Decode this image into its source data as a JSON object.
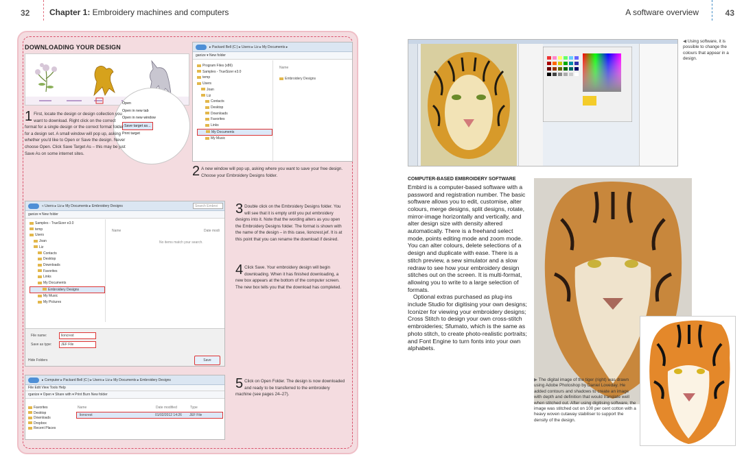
{
  "header": {
    "left_page_number": "32",
    "left_chapter_bold": "Chapter 1:",
    "left_chapter_rest": " Embroidery machines and computers",
    "right_section": "A software overview",
    "right_page_number": "43"
  },
  "panel": {
    "title": "DOWNLOADING YOUR DESIGN",
    "step1": {
      "num": "1",
      "text": "First, locate the design or design collection you want to download. Right click on the correct format for a single design or the correct format folder for a design set. A small window will pop up, asking whether you'd like to Open or Save the design. Never choose Open. Click Save Target As – this may be just Save As on some internet sites."
    },
    "step2": {
      "num": "2",
      "text": "A new window will pop up, asking where you want to save your free design. Choose your Embroidery Designs folder."
    },
    "step3": {
      "num": "3",
      "text": "Double click on the Embroidery Designs folder. You will see that it is empty until you put embroidery designs into it. Note that the wording alters as you open the Embroidery Designs folder. The format is shown with the name of the design – in this case, lioncrest.jef. It is at this point that you can rename the download if desired."
    },
    "step4": {
      "num": "4",
      "text": "Click Save. Your embroidery design will begin downloading. When it has finished downloading, a new box appears at the bottom of the computer screen. The new box tells you that the download has completed."
    },
    "step5": {
      "num": "5",
      "text": "Click on Open Folder. The design is now downloaded and ready to be transferred to the embroidery machine (see pages 24–27)."
    },
    "context_menu": [
      "Open",
      "Open in new tab",
      "Open in new window",
      "Save target as...",
      "Print target"
    ],
    "explorer1": {
      "path": "▸ Packard Bell (C:) ▸ Users ▸ Liz ▸ My Documents ▸",
      "toolbar": "ganize ▾     New folder",
      "tree": [
        "Program Files (x86)",
        "Samples - TrueSizer e3.0",
        "temp",
        "Users",
        "Joan",
        "Liz",
        "Contacts",
        "Desktop",
        "Downloads",
        "Favorites",
        "Links",
        "My Documents",
        "My Music"
      ],
      "col_header": "Name",
      "item": "Embroidery Designs"
    },
    "explorer2": {
      "path": "« Users ▸ Liz ▸ My Documents ▸ Embroidery Designs",
      "search": "Search Embroi",
      "toolbar": "ganize ▾     New folder",
      "tree": [
        "Samples - TrueSizer e3.0",
        "temp",
        "Users",
        "Joan",
        "Liz",
        "Contacts",
        "Desktop",
        "Downloads",
        "Favorites",
        "Links",
        "My Documents",
        "Embroidery Designs",
        "My Music",
        "My Pictures"
      ],
      "col_name": "Name",
      "col_date": "Date modi",
      "empty_msg": "No items match your search.",
      "file_name_label": "File name:",
      "file_name_value": "lioncrest",
      "save_type_label": "Save as type:",
      "save_type_value": "JEF File",
      "hide_folders": "Hide Folders",
      "save_button": "Save"
    },
    "explorer3": {
      "path": "▸ Computer ▸ Packard Bell (C:) ▸ Users ▸ Liz ▸ My Documents ▸ Embroidery Designs",
      "menu": "File   Edit   View   Tools   Help",
      "toolbar": "rganize ▾   Open ▾   Share with ▾   Print   Burn   New folder",
      "tree": [
        "Favorites",
        "Desktop",
        "Downloads",
        "Dropbox",
        "Recent Places"
      ],
      "col_name": "Name",
      "col_date": "Date modified",
      "col_type": "Type",
      "file": "lioncrest",
      "file_date": "01/02/2012 14:26",
      "file_type": "JEF File"
    }
  },
  "right": {
    "caption_top": "Using software, it is possible to change the colours that appear in a design.",
    "heading": "COMPUTER-BASED EMBROIDERY SOFTWARE",
    "para1": "Embird is a computer-based software with a password and registration number. The basic software allows you to edit, customise, alter colours, merge designs, split designs, rotate, mirror-image horizontally and vertically, and alter design size with density altered automatically. There is a freehand select mode, points editing mode and zoom mode. You can alter colours, delete selections of a design and duplicate with ease. There is a stitch preview, a sew simulator and a slow redraw to see how your embroidery design stitches out on the screen. It is multi-format, allowing you to write to a large selection of formats.",
    "para2": "Optional extras purchased as plug-ins include Studio for digitising your own designs; Iconizer for viewing your embroidery designs; Cross Stitch to design your own cross-stitch embroideries; Sfumato, which is the same as photo stitch, to create photo-realistic portraits; and Font Engine to turn fonts into your own alphabets.",
    "caption_bottom": "The digital image of the tiger (right) was drawn using Adobe Photoshop by Daniel Loveday. He added contours and shadows to create an image with depth and definition that would translate well when stitched out. After using digitising software, the image was stitched out on 100 per cent cotton with a heavy woven cutaway stabiliser to support the density of the design."
  },
  "colors": {
    "panel_bg": "#f4dce0",
    "panel_border": "#d8506a",
    "header_left_rule": "#e06a7a",
    "header_right_rule": "#3b88c4"
  }
}
